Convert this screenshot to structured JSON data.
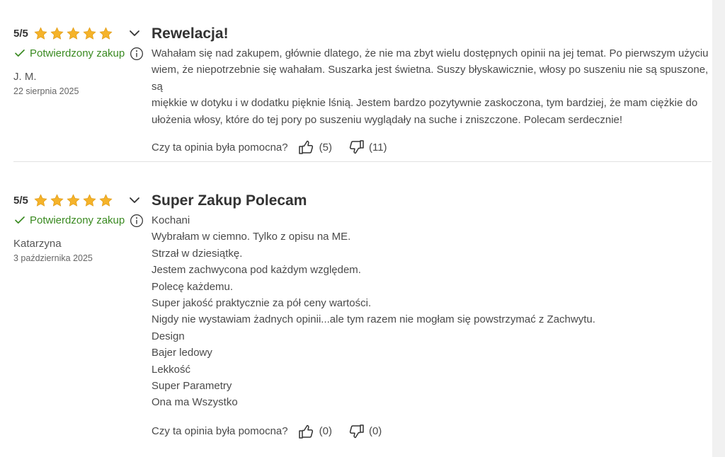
{
  "reviews": [
    {
      "rating_text": "5/5",
      "stars": 5,
      "verified_label": "Potwierdzony zakup",
      "author": "J. M.",
      "date": "22 sierpnia 2025",
      "title": "Rewelacja!",
      "body_lines": [
        "Wahałam się nad zakupem, głównie dlatego, że nie ma zbyt wielu dostępnych opinii na jej temat. Po pierwszym użyciu",
        "wiem, że niepotrzebnie się wahałam. Suszarka jest świetna. Suszy błyskawicznie, włosy po suszeniu nie są spuszone, są",
        "miękkie w dotyku i w dodatku pięknie lśnią. Jestem bardzo pozytywnie zaskoczona, tym bardziej, że mam ciężkie do",
        "ułożenia włosy, które do tej pory po suszeniu wyglądały na suche i zniszczone. Polecam serdecznie!"
      ],
      "helpful_question": "Czy ta opinia była pomocna?",
      "upvotes": "(5)",
      "downvotes": "(11)"
    },
    {
      "rating_text": "5/5",
      "stars": 5,
      "verified_label": "Potwierdzony zakup",
      "author": "Katarzyna",
      "date": "3 października 2025",
      "title": "Super Zakup Polecam",
      "body_lines": [
        "Kochani",
        "Wybrałam w ciemno. Tylko z opisu na ME.",
        "Strzał w dziesiątkę.",
        "Jestem zachwycona pod każdym względem.",
        "Polecę każdemu.",
        "Super jakość praktycznie za pół ceny wartości.",
        "Nigdy nie wystawiam żadnych opinii...ale tym razem nie mogłam się powstrzymać z Zachwytu.",
        "Design",
        "Bajer ledowy",
        "Lekkość",
        "Super Parametry",
        "Ona ma Wszystko"
      ],
      "helpful_question": "Czy ta opinia była pomocna?",
      "upvotes": "(0)",
      "downvotes": "(0)"
    }
  ],
  "colors": {
    "star": "#f5b32a",
    "verified": "#3a8a21",
    "text": "#4a4a4a"
  },
  "icons": [
    "star-icon",
    "chevron-down-icon",
    "check-icon",
    "info-icon",
    "thumbs-up-icon",
    "thumbs-down-icon"
  ]
}
